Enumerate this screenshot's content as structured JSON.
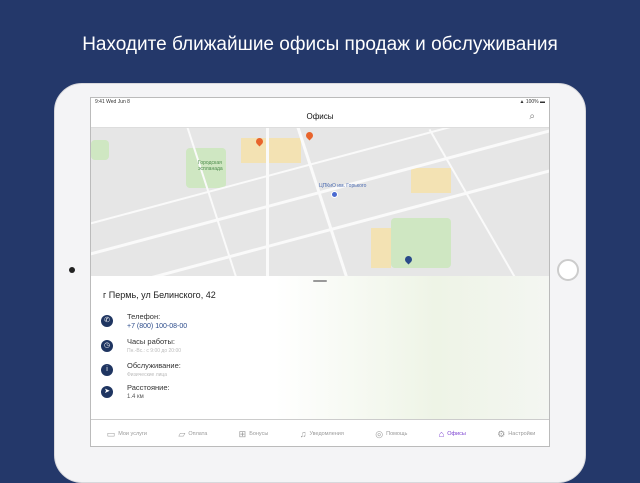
{
  "headline": "Находите ближайшие офисы продаж и обслуживания",
  "status": {
    "time": "9:41",
    "date": "Wed Jun 8",
    "battery": "100%"
  },
  "nav": {
    "title": "Офисы",
    "search_icon": "search-icon"
  },
  "map": {
    "labels": [
      "Городская эспланада",
      "ЦПКиО им. Горького"
    ],
    "colors": {
      "pin_orange": "#e8642c",
      "pin_blue": "#2a4a8a"
    }
  },
  "office": {
    "address": "г Пермь, ул Белинского, 42",
    "details": [
      {
        "icon": "phone-icon",
        "label": "Телефон:",
        "value": "+7 (800) 100-08-00"
      },
      {
        "icon": "clock-icon",
        "label": "Часы работы:",
        "value": "Пн.-Вс.: с 9:00 до 20:00"
      },
      {
        "icon": "info-icon",
        "label": "Обслуживание:",
        "value": "Физические лица"
      },
      {
        "icon": "location-arrow-icon",
        "label": "Расстояние:",
        "value": "1.4 км"
      }
    ]
  },
  "tabs": [
    {
      "icon": "monitor-icon",
      "glyph": "▭",
      "label": "Мои услуги"
    },
    {
      "icon": "folder-icon",
      "glyph": "▱",
      "label": "Оплата"
    },
    {
      "icon": "gift-icon",
      "glyph": "⊞",
      "label": "Бонусы"
    },
    {
      "icon": "bell-icon",
      "glyph": "♫",
      "label": "Уведомления"
    },
    {
      "icon": "lifebuoy-icon",
      "glyph": "◎",
      "label": "Помощь"
    },
    {
      "icon": "offices-icon",
      "glyph": "⌂",
      "label": "Офисы",
      "active": true
    },
    {
      "icon": "gear-icon",
      "glyph": "⚙",
      "label": "Настройки"
    }
  ],
  "accent": "#7a3fd0"
}
